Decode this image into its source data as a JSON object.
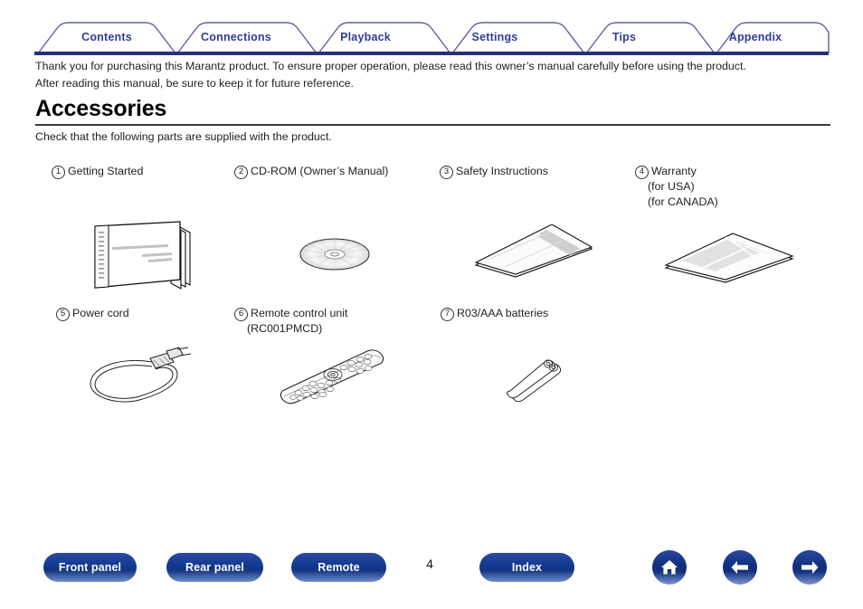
{
  "tabs": [
    {
      "label": "Contents"
    },
    {
      "label": "Connections"
    },
    {
      "label": "Playback"
    },
    {
      "label": "Settings"
    },
    {
      "label": "Tips"
    },
    {
      "label": "Appendix"
    }
  ],
  "intro": {
    "line1": "Thank you for purchasing this Marantz product. To ensure proper operation, please read this owner’s manual carefully before using the product.",
    "line2": "After reading this manual, be sure to keep it for future reference."
  },
  "heading": {
    "title": "Accessories",
    "subtitle": "Check that the following parts are supplied with the product."
  },
  "accessories": [
    {
      "num": "1",
      "label": "Getting Started",
      "sub1": "",
      "sub2": "",
      "art": "booklet"
    },
    {
      "num": "2",
      "label": "CD-ROM (Owner’s Manual)",
      "sub1": "",
      "sub2": "",
      "art": "cdrom"
    },
    {
      "num": "3",
      "label": "Safety Instructions",
      "sub1": "",
      "sub2": "",
      "art": "sheet"
    },
    {
      "num": "4",
      "label": "Warranty",
      "sub1": "(for USA)",
      "sub2": "(for CANADA)",
      "art": "warranty"
    },
    {
      "num": "5",
      "label": "Power cord",
      "sub1": "",
      "sub2": "",
      "art": "cord"
    },
    {
      "num": "6",
      "label": "Remote control unit",
      "sub1": "(RC001PMCD)",
      "sub2": "",
      "art": "remote"
    },
    {
      "num": "7",
      "label": "R03/AAA batteries",
      "sub1": "",
      "sub2": "",
      "art": "batteries"
    }
  ],
  "footer": {
    "buttons": [
      {
        "label": "Front panel"
      },
      {
        "label": "Rear panel"
      },
      {
        "label": "Remote"
      },
      {
        "label": "Index"
      }
    ],
    "page_number": "4",
    "icons": [
      {
        "name": "home-icon"
      },
      {
        "name": "arrow-left-icon"
      },
      {
        "name": "arrow-right-icon"
      }
    ]
  },
  "colors": {
    "tab_text": "#2f3d93",
    "tab_border": "#5b5fa8",
    "baseline": "#26307a",
    "button_blue": "#12347f"
  }
}
